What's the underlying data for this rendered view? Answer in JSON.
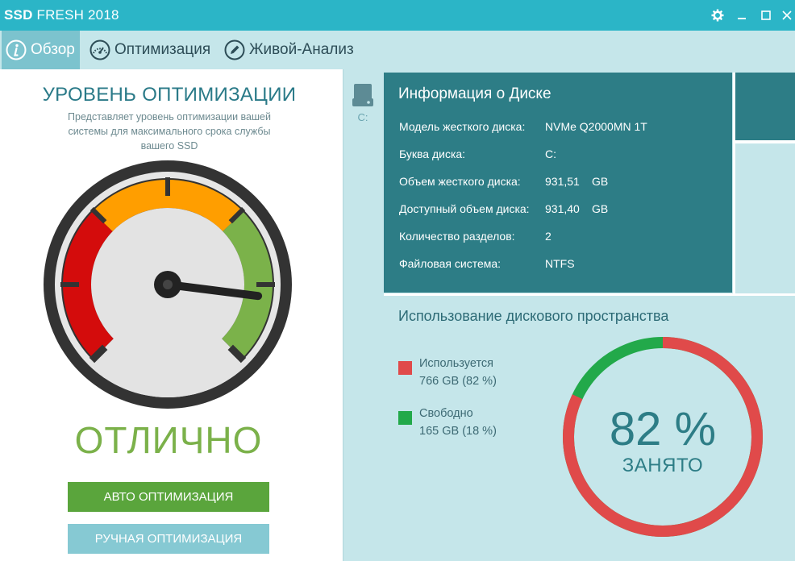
{
  "window": {
    "title_bold": "SSD",
    "title_rest": " FRESH 2018",
    "colors": {
      "titlebar": "#2bb5c7",
      "accent": "#2d7d86"
    }
  },
  "tabs": [
    {
      "label": "Обзор",
      "icon": "info-icon",
      "active": true
    },
    {
      "label": "Оптимизация",
      "icon": "speedometer-icon"
    },
    {
      "label": "Живой-Анализ",
      "icon": "pencil-icon"
    }
  ],
  "optimization": {
    "title": "УРОВЕНЬ ОПТИМИЗАЦИИ",
    "description": "Представляет уровень оптимизации вашей системы для максимального срока службы вашего SSD",
    "status": "ОТЛИЧНО",
    "gauge_level": 0.86,
    "auto_button": "АВТО ОПТИМИЗАЦИЯ",
    "manual_button": "РУЧНАЯ ОПТИМИЗАЦИЯ"
  },
  "drives": [
    {
      "label": "C:",
      "icon": "drive-icon"
    }
  ],
  "disk_info": {
    "title": "Информация о Диске",
    "rows": [
      {
        "label": "Модель жесткого диска:",
        "value": "NVMe Q2000MN 1T",
        "unit": ""
      },
      {
        "label": "Буква диска:",
        "value": "C:",
        "unit": ""
      },
      {
        "label": "Объем жесткого диска:",
        "value": "931,51",
        "unit": "GB"
      },
      {
        "label": "Доступный объем диска:",
        "value": "931,40",
        "unit": "GB"
      },
      {
        "label": "Количество разделов:",
        "value": "2",
        "unit": ""
      },
      {
        "label": "Файловая система:",
        "value": "NTFS",
        "unit": ""
      }
    ]
  },
  "usage": {
    "title": "Использование дискового пространства",
    "legend": [
      {
        "name": "Используется",
        "value": "766 GB (82 %)",
        "color": "#e04a4a"
      },
      {
        "name": "Свободно",
        "value": "165 GB (18 %)",
        "color": "#22a94a"
      }
    ],
    "used_fraction": 0.82,
    "center_percent": "82 %",
    "center_label": "ЗАНЯТО"
  }
}
